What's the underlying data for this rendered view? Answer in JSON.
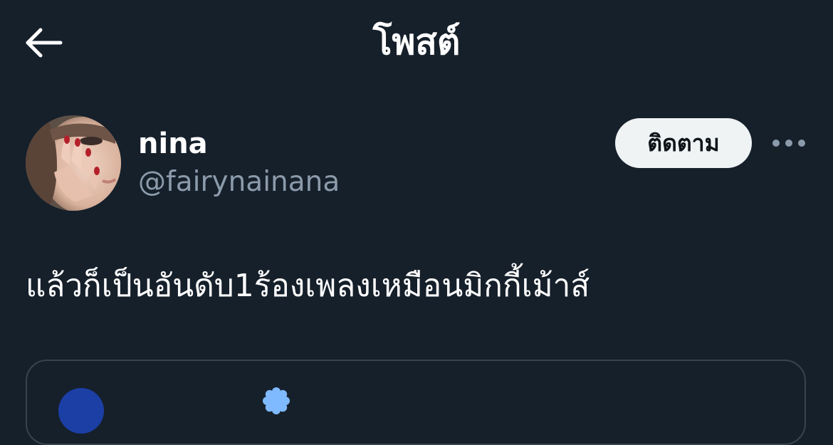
{
  "header": {
    "title": "โพสต์",
    "back_icon": "arrow-left-icon"
  },
  "author": {
    "display_name": "nina",
    "handle": "@fairynainana",
    "avatar_icon": "avatar-photo"
  },
  "actions": {
    "follow_label": "ติดตาม",
    "more_icon": "ellipsis-icon"
  },
  "post": {
    "text": "แล้วก็เป็นอันดับ1ร้องเพลงเหมือนมิกกี้เม้าส์"
  },
  "quoted_post": {
    "avatar_icon": "avatar-blue",
    "verified_icon": "verified-badge-icon"
  },
  "colors": {
    "background": "#16202b",
    "text_primary": "#ffffff",
    "text_secondary": "#8c9bab",
    "follow_button_bg": "#eff3f4",
    "card_border": "#38444d",
    "verified_badge": "#7fb9ff"
  }
}
